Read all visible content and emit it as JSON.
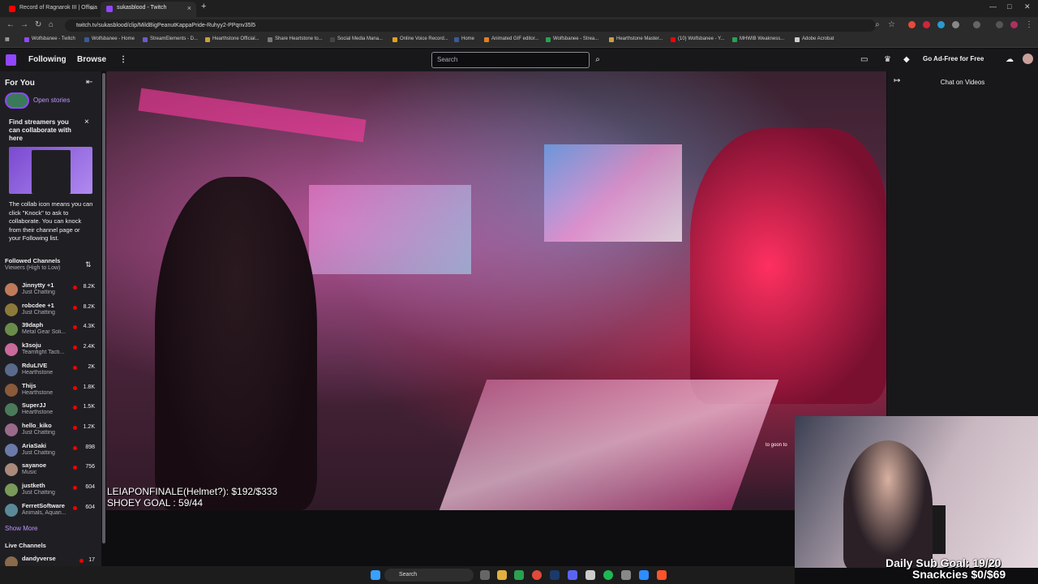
{
  "browser": {
    "tabs": [
      {
        "title": "Record of Ragnarok III | Officia",
        "active": false
      },
      {
        "title": "sukasblood - Twitch",
        "active": true
      }
    ],
    "new_tab": "+",
    "url": "twitch.tv/sukasblood/clip/MildBigPeanutKappaPride-Ruhyy2-PPqnv35l5",
    "bookmarks": [
      "Wolfsbanee - Twitch",
      "Wolfsbanee - Home",
      "StreamElements - D...",
      "Hearthstone Official...",
      "Share Heartstone to...",
      "Social Media Mana...",
      "Online Voice Record...",
      "Home",
      "Animated GIF editor...",
      "Wolfsbanee - Strea...",
      "Hearthstone Master...",
      "(10) Wolfsbanee - Y...",
      "MHWIB Weakness...",
      "Adobe Acrobat"
    ]
  },
  "topnav": {
    "following": "Following",
    "browse": "Browse",
    "more": "⋮",
    "search_placeholder": "Search",
    "ad_free": "Go Ad-Free for Free"
  },
  "sidebar": {
    "for_you": "For You",
    "open_stories": "Open stories",
    "collab_card": {
      "title": "Find streamers you can collaborate with here",
      "body": "The collab icon means you can click \"Knock\" to ask to collaborate. You can knock from their channel page or your Following list."
    },
    "followed_header": "Followed Channels",
    "followed_sort": "Viewers (High to Low)",
    "channels": [
      {
        "name": "Jinnytty +1",
        "game": "Just Chatting",
        "viewers": "8.2K",
        "color": "#c07a5a"
      },
      {
        "name": "robcdee +1",
        "game": "Just Chatting",
        "viewers": "8.2K",
        "color": "#8c7a3a"
      },
      {
        "name": "39daph",
        "game": "Metal Gear Soli...",
        "viewers": "4.3K",
        "color": "#6a8c4a"
      },
      {
        "name": "k3soju",
        "game": "Teamfight Tacti...",
        "viewers": "2.4K",
        "color": "#c86a9a"
      },
      {
        "name": "RduLIVE",
        "game": "Hearthstone",
        "viewers": "2K",
        "color": "#5a6a8c"
      },
      {
        "name": "Thijs",
        "game": "Hearthstone",
        "viewers": "1.8K",
        "color": "#8a5a3a"
      },
      {
        "name": "SuperJJ",
        "game": "Hearthstone",
        "viewers": "1.5K",
        "color": "#4a7a5a"
      },
      {
        "name": "hello_kiko",
        "game": "Just Chatting",
        "viewers": "1.2K",
        "color": "#9a6a8a"
      },
      {
        "name": "AriaSaki",
        "game": "Just Chatting",
        "viewers": "898",
        "color": "#6a7aaa"
      },
      {
        "name": "sayanoe",
        "game": "Music",
        "viewers": "756",
        "color": "#aa8a7a"
      },
      {
        "name": "justketh",
        "game": "Just Chatting",
        "viewers": "604",
        "color": "#7a9a5a"
      },
      {
        "name": "FerretSoftware",
        "game": "Animals, Aquari...",
        "viewers": "604",
        "color": "#5a8a9a"
      }
    ],
    "show_more": "Show More",
    "live_header": "Live Channels",
    "live_first": {
      "name": "dandyverse",
      "viewers": "17",
      "color": "#8a6a4a"
    }
  },
  "video": {
    "overlay_line1": "LEIAPONFINALE(Helmet?): $192/$333",
    "overlay_line2": "SHOEY GOAL : 59/44",
    "chat_fragment": "to goon to"
  },
  "chat": {
    "title": "Chat on Videos"
  },
  "cam": {
    "sub_goal": "Daily Sub Goal: 19/20",
    "snack_goal": "Snackcies $0/$69"
  },
  "taskbar": {
    "search": "Search"
  },
  "colors": {
    "twitch_purple": "#9147ff",
    "live_red": "#eb0400"
  }
}
